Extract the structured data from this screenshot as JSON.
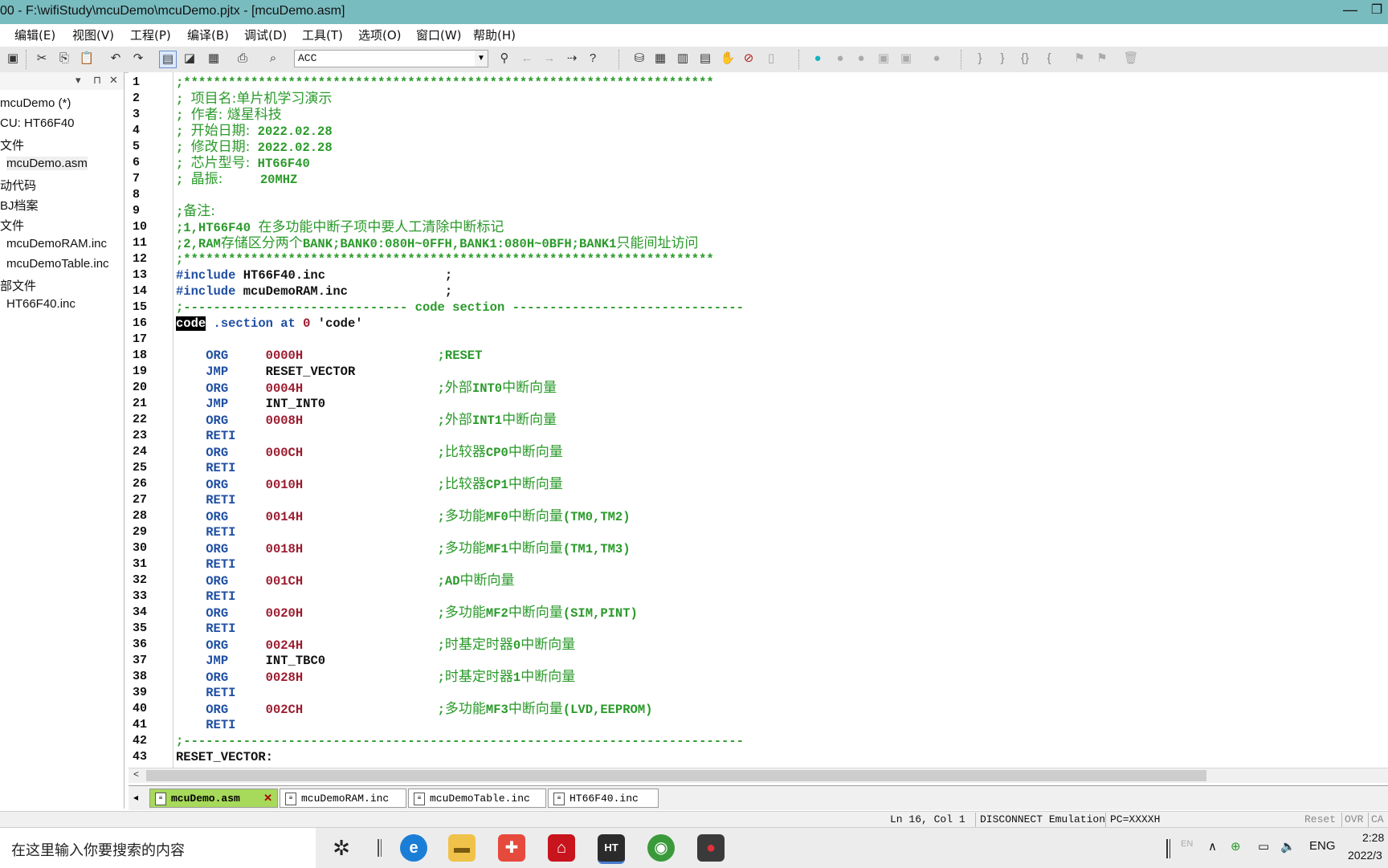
{
  "window": {
    "title": "00 - F:\\wifiStudy\\mcuDemo\\mcuDemo.pjtx - [mcuDemo.asm]",
    "minimize": "—",
    "maximize": "❐"
  },
  "menu": [
    "编辑(E)",
    "视图(V)",
    "工程(P)",
    "编译(B)",
    "调试(D)",
    "工具(T)",
    "选项(O)",
    "窗口(W)",
    "帮助(H)"
  ],
  "toolbar": {
    "combo_value": "ACC",
    "icons": [
      "save-all",
      "cut",
      "copy",
      "paste",
      "undo",
      "redo",
      "project-window",
      "output-window",
      "watch-window",
      "print",
      "find-in-files",
      "find",
      "back",
      "forward",
      "jump",
      "help",
      "compile",
      "build",
      "rebuild",
      "step",
      "run-to",
      "stop",
      "breakpoint",
      "emulate",
      "go",
      "step-into",
      "step-over",
      "step-out",
      "reset",
      "clear"
    ]
  },
  "sidebar": {
    "controls": [
      "▾",
      "⊓",
      "✕"
    ],
    "items": [
      {
        "label": "mcuDemo (*)"
      },
      {
        "label": "CU: HT66F40"
      },
      {
        "label": "文件"
      },
      {
        "label": "mcuDemo.asm"
      },
      {
        "label": "动代码"
      },
      {
        "label": "BJ档案"
      },
      {
        "label": "文件"
      },
      {
        "label": "mcuDemoRAM.inc"
      },
      {
        "label": "mcuDemoTable.inc"
      },
      {
        "label": "部文件"
      },
      {
        "label": "HT66F40.inc"
      }
    ]
  },
  "editor": {
    "lines": [
      {
        "n": "1",
        "parts": [
          {
            "t": ";***********************************************************************",
            "c": "cmb"
          }
        ]
      },
      {
        "n": "2",
        "parts": [
          {
            "t": "; ",
            "c": "cmb"
          },
          {
            "t": "项目名:单片机学习演示",
            "c": "cm c-text"
          }
        ]
      },
      {
        "n": "3",
        "parts": [
          {
            "t": "; ",
            "c": "cmb"
          },
          {
            "t": "作者: 燧星科技",
            "c": "cm c-text"
          }
        ]
      },
      {
        "n": "4",
        "parts": [
          {
            "t": "; ",
            "c": "cmb"
          },
          {
            "t": "开始日期:",
            "c": "cm c-text"
          },
          {
            "t": " 2022.02.28",
            "c": "cmb"
          }
        ]
      },
      {
        "n": "5",
        "parts": [
          {
            "t": "; ",
            "c": "cmb"
          },
          {
            "t": "修改日期:",
            "c": "cm c-text"
          },
          {
            "t": " 2022.02.28",
            "c": "cmb"
          }
        ]
      },
      {
        "n": "6",
        "parts": [
          {
            "t": "; ",
            "c": "cmb"
          },
          {
            "t": "芯片型号:",
            "c": "cm c-text"
          },
          {
            "t": " HT66F40",
            "c": "cmb"
          }
        ]
      },
      {
        "n": "7",
        "parts": [
          {
            "t": "; ",
            "c": "cmb"
          },
          {
            "t": "晶振:",
            "c": "cm c-text"
          },
          {
            "t": "     20MHZ",
            "c": "cmb"
          }
        ]
      },
      {
        "n": "8",
        "parts": []
      },
      {
        "n": "9",
        "parts": [
          {
            "t": ";",
            "c": "cmb"
          },
          {
            "t": "备注:",
            "c": "cm c-text"
          }
        ]
      },
      {
        "n": "10",
        "parts": [
          {
            "t": ";1,HT66F40 ",
            "c": "cmb"
          },
          {
            "t": "在多功能中断子项中要人工清除中断标记",
            "c": "cm c-text"
          }
        ]
      },
      {
        "n": "11",
        "parts": [
          {
            "t": ";2,RAM",
            "c": "cmb"
          },
          {
            "t": "存储区分两个",
            "c": "cm c-text"
          },
          {
            "t": "BANK;BANK0:080H~0FFH,BANK1:080H~0BFH;BANK1",
            "c": "cmb"
          },
          {
            "t": "只能间址访问",
            "c": "cm c-text"
          }
        ]
      },
      {
        "n": "12",
        "parts": [
          {
            "t": ";***********************************************************************",
            "c": "cmb"
          }
        ]
      },
      {
        "n": "13",
        "parts": [
          {
            "t": "#include",
            "c": "pp"
          },
          {
            "t": " HT66F40.inc                ;",
            "c": "str"
          }
        ]
      },
      {
        "n": "14",
        "parts": [
          {
            "t": "#include",
            "c": "pp"
          },
          {
            "t": " mcuDemoRAM.inc             ;",
            "c": "str"
          }
        ]
      },
      {
        "n": "15",
        "parts": [
          {
            "t": ";------------------------------ code section -------------------------------",
            "c": "cmb"
          }
        ]
      },
      {
        "n": "16",
        "parts": [
          {
            "t": "code",
            "c": "sel"
          },
          {
            "t": " ",
            "c": "str"
          },
          {
            "t": ".section at",
            "c": "kw"
          },
          {
            "t": " 0 ",
            "c": "num"
          },
          {
            "t": "'code'",
            "c": "str"
          }
        ]
      },
      {
        "n": "17",
        "parts": []
      },
      {
        "n": "18",
        "parts": [
          {
            "t": "    ",
            "c": "str"
          },
          {
            "t": "ORG",
            "c": "kw"
          },
          {
            "t": "     ",
            "c": "str"
          },
          {
            "t": "0000H",
            "c": "num"
          },
          {
            "t": "                  ",
            "c": "str"
          },
          {
            "t": ";RESET",
            "c": "cmb"
          }
        ]
      },
      {
        "n": "19",
        "parts": [
          {
            "t": "    ",
            "c": "str"
          },
          {
            "t": "JMP",
            "c": "kw"
          },
          {
            "t": "     RESET_VECTOR",
            "c": "str"
          }
        ]
      },
      {
        "n": "20",
        "parts": [
          {
            "t": "    ",
            "c": "str"
          },
          {
            "t": "ORG",
            "c": "kw"
          },
          {
            "t": "     ",
            "c": "str"
          },
          {
            "t": "0004H",
            "c": "num"
          },
          {
            "t": "                  ",
            "c": "str"
          },
          {
            "t": ";",
            "c": "cmb"
          },
          {
            "t": "外部",
            "c": "cm c-text"
          },
          {
            "t": "INT0",
            "c": "cmb"
          },
          {
            "t": "中断向量",
            "c": "cm c-text"
          }
        ]
      },
      {
        "n": "21",
        "parts": [
          {
            "t": "    ",
            "c": "str"
          },
          {
            "t": "JMP",
            "c": "kw"
          },
          {
            "t": "     INT_INT0",
            "c": "str"
          }
        ]
      },
      {
        "n": "22",
        "parts": [
          {
            "t": "    ",
            "c": "str"
          },
          {
            "t": "ORG",
            "c": "kw"
          },
          {
            "t": "     ",
            "c": "str"
          },
          {
            "t": "0008H",
            "c": "num"
          },
          {
            "t": "                  ",
            "c": "str"
          },
          {
            "t": ";",
            "c": "cmb"
          },
          {
            "t": "外部",
            "c": "cm c-text"
          },
          {
            "t": "INT1",
            "c": "cmb"
          },
          {
            "t": "中断向量",
            "c": "cm c-text"
          }
        ]
      },
      {
        "n": "23",
        "parts": [
          {
            "t": "    ",
            "c": "str"
          },
          {
            "t": "RETI",
            "c": "kw"
          }
        ]
      },
      {
        "n": "24",
        "parts": [
          {
            "t": "    ",
            "c": "str"
          },
          {
            "t": "ORG",
            "c": "kw"
          },
          {
            "t": "     ",
            "c": "str"
          },
          {
            "t": "000CH",
            "c": "num"
          },
          {
            "t": "                  ",
            "c": "str"
          },
          {
            "t": ";",
            "c": "cmb"
          },
          {
            "t": "比较器",
            "c": "cm c-text"
          },
          {
            "t": "CP0",
            "c": "cmb"
          },
          {
            "t": "中断向量",
            "c": "cm c-text"
          }
        ]
      },
      {
        "n": "25",
        "parts": [
          {
            "t": "    ",
            "c": "str"
          },
          {
            "t": "RETI",
            "c": "kw"
          }
        ]
      },
      {
        "n": "26",
        "parts": [
          {
            "t": "    ",
            "c": "str"
          },
          {
            "t": "ORG",
            "c": "kw"
          },
          {
            "t": "     ",
            "c": "str"
          },
          {
            "t": "0010H",
            "c": "num"
          },
          {
            "t": "                  ",
            "c": "str"
          },
          {
            "t": ";",
            "c": "cmb"
          },
          {
            "t": "比较器",
            "c": "cm c-text"
          },
          {
            "t": "CP1",
            "c": "cmb"
          },
          {
            "t": "中断向量",
            "c": "cm c-text"
          }
        ]
      },
      {
        "n": "27",
        "parts": [
          {
            "t": "    ",
            "c": "str"
          },
          {
            "t": "RETI",
            "c": "kw"
          }
        ]
      },
      {
        "n": "28",
        "parts": [
          {
            "t": "    ",
            "c": "str"
          },
          {
            "t": "ORG",
            "c": "kw"
          },
          {
            "t": "     ",
            "c": "str"
          },
          {
            "t": "0014H",
            "c": "num"
          },
          {
            "t": "                  ",
            "c": "str"
          },
          {
            "t": ";",
            "c": "cmb"
          },
          {
            "t": "多功能",
            "c": "cm c-text"
          },
          {
            "t": "MF0",
            "c": "cmb"
          },
          {
            "t": "中断向量",
            "c": "cm c-text"
          },
          {
            "t": "(TM0,TM2)",
            "c": "cmb"
          }
        ]
      },
      {
        "n": "29",
        "parts": [
          {
            "t": "    ",
            "c": "str"
          },
          {
            "t": "RETI",
            "c": "kw"
          }
        ]
      },
      {
        "n": "30",
        "parts": [
          {
            "t": "    ",
            "c": "str"
          },
          {
            "t": "ORG",
            "c": "kw"
          },
          {
            "t": "     ",
            "c": "str"
          },
          {
            "t": "0018H",
            "c": "num"
          },
          {
            "t": "                  ",
            "c": "str"
          },
          {
            "t": ";",
            "c": "cmb"
          },
          {
            "t": "多功能",
            "c": "cm c-text"
          },
          {
            "t": "MF1",
            "c": "cmb"
          },
          {
            "t": "中断向量",
            "c": "cm c-text"
          },
          {
            "t": "(TM1,TM3)",
            "c": "cmb"
          }
        ]
      },
      {
        "n": "31",
        "parts": [
          {
            "t": "    ",
            "c": "str"
          },
          {
            "t": "RETI",
            "c": "kw"
          }
        ]
      },
      {
        "n": "32",
        "parts": [
          {
            "t": "    ",
            "c": "str"
          },
          {
            "t": "ORG",
            "c": "kw"
          },
          {
            "t": "     ",
            "c": "str"
          },
          {
            "t": "001CH",
            "c": "num"
          },
          {
            "t": "                  ",
            "c": "str"
          },
          {
            "t": ";AD",
            "c": "cmb"
          },
          {
            "t": "中断向量",
            "c": "cm c-text"
          }
        ]
      },
      {
        "n": "33",
        "parts": [
          {
            "t": "    ",
            "c": "str"
          },
          {
            "t": "RETI",
            "c": "kw"
          }
        ]
      },
      {
        "n": "34",
        "parts": [
          {
            "t": "    ",
            "c": "str"
          },
          {
            "t": "ORG",
            "c": "kw"
          },
          {
            "t": "     ",
            "c": "str"
          },
          {
            "t": "0020H",
            "c": "num"
          },
          {
            "t": "                  ",
            "c": "str"
          },
          {
            "t": ";",
            "c": "cmb"
          },
          {
            "t": "多功能",
            "c": "cm c-text"
          },
          {
            "t": "MF2",
            "c": "cmb"
          },
          {
            "t": "中断向量",
            "c": "cm c-text"
          },
          {
            "t": "(SIM,PINT)",
            "c": "cmb"
          }
        ]
      },
      {
        "n": "35",
        "parts": [
          {
            "t": "    ",
            "c": "str"
          },
          {
            "t": "RETI",
            "c": "kw"
          }
        ]
      },
      {
        "n": "36",
        "parts": [
          {
            "t": "    ",
            "c": "str"
          },
          {
            "t": "ORG",
            "c": "kw"
          },
          {
            "t": "     ",
            "c": "str"
          },
          {
            "t": "0024H",
            "c": "num"
          },
          {
            "t": "                  ",
            "c": "str"
          },
          {
            "t": ";",
            "c": "cmb"
          },
          {
            "t": "时基定时器",
            "c": "cm c-text"
          },
          {
            "t": "0",
            "c": "cmb"
          },
          {
            "t": "中断向量",
            "c": "cm c-text"
          }
        ]
      },
      {
        "n": "37",
        "parts": [
          {
            "t": "    ",
            "c": "str"
          },
          {
            "t": "JMP",
            "c": "kw"
          },
          {
            "t": "     INT_TBC0",
            "c": "str"
          }
        ]
      },
      {
        "n": "38",
        "parts": [
          {
            "t": "    ",
            "c": "str"
          },
          {
            "t": "ORG",
            "c": "kw"
          },
          {
            "t": "     ",
            "c": "str"
          },
          {
            "t": "0028H",
            "c": "num"
          },
          {
            "t": "                  ",
            "c": "str"
          },
          {
            "t": ";",
            "c": "cmb"
          },
          {
            "t": "时基定时器",
            "c": "cm c-text"
          },
          {
            "t": "1",
            "c": "cmb"
          },
          {
            "t": "中断向量",
            "c": "cm c-text"
          }
        ]
      },
      {
        "n": "39",
        "parts": [
          {
            "t": "    ",
            "c": "str"
          },
          {
            "t": "RETI",
            "c": "kw"
          }
        ]
      },
      {
        "n": "40",
        "parts": [
          {
            "t": "    ",
            "c": "str"
          },
          {
            "t": "ORG",
            "c": "kw"
          },
          {
            "t": "     ",
            "c": "str"
          },
          {
            "t": "002CH",
            "c": "num"
          },
          {
            "t": "                  ",
            "c": "str"
          },
          {
            "t": ";",
            "c": "cmb"
          },
          {
            "t": "多功能",
            "c": "cm c-text"
          },
          {
            "t": "MF3",
            "c": "cmb"
          },
          {
            "t": "中断向量",
            "c": "cm c-text"
          },
          {
            "t": "(LVD,EEPROM)",
            "c": "cmb"
          }
        ]
      },
      {
        "n": "41",
        "parts": [
          {
            "t": "    ",
            "c": "str"
          },
          {
            "t": "RETI",
            "c": "kw"
          }
        ]
      },
      {
        "n": "42",
        "parts": [
          {
            "t": ";---------------------------------------------------------------------------",
            "c": "cmb"
          }
        ]
      },
      {
        "n": "43",
        "parts": [
          {
            "t": "RESET_VECTOR:",
            "c": "str"
          }
        ]
      }
    ]
  },
  "tabs": [
    {
      "label": "mcuDemo.asm",
      "active": true,
      "close": "✕"
    },
    {
      "label": "mcuDemoRAM.inc",
      "active": false
    },
    {
      "label": "mcuDemoTable.inc",
      "active": false
    },
    {
      "label": "HT66F40.inc",
      "active": false
    }
  ],
  "status": {
    "position": "Ln 16, Col 1",
    "mode": "DISCONNECT Emulation",
    "pc": "PC=XXXXH",
    "reset": "Reset",
    "ovr": "OVR",
    "cap": "CA"
  },
  "taskbar": {
    "search_placeholder": "在这里输入你要搜索的内容",
    "apps": [
      {
        "name": "task-view",
        "glyph": "✲"
      },
      {
        "name": "edge",
        "glyph": "e"
      },
      {
        "name": "explorer",
        "glyph": "▬"
      },
      {
        "name": "puzzle-app",
        "glyph": "✚"
      },
      {
        "name": "pdf-reader",
        "glyph": "⌂"
      },
      {
        "name": "ht-ide",
        "glyph": "HT"
      },
      {
        "name": "chrome",
        "glyph": "◉"
      },
      {
        "name": "recorder",
        "glyph": "●"
      }
    ],
    "lang_small": "EN",
    "lang": "ENG",
    "time": "2:28",
    "date": "2022/3"
  },
  "colors": {
    "title_bar": "#79bcc0",
    "comment": "#2a9a2a",
    "keyword": "#1f4fa3",
    "number": "#9b1a2e",
    "active_tab": "#a7d95a"
  }
}
